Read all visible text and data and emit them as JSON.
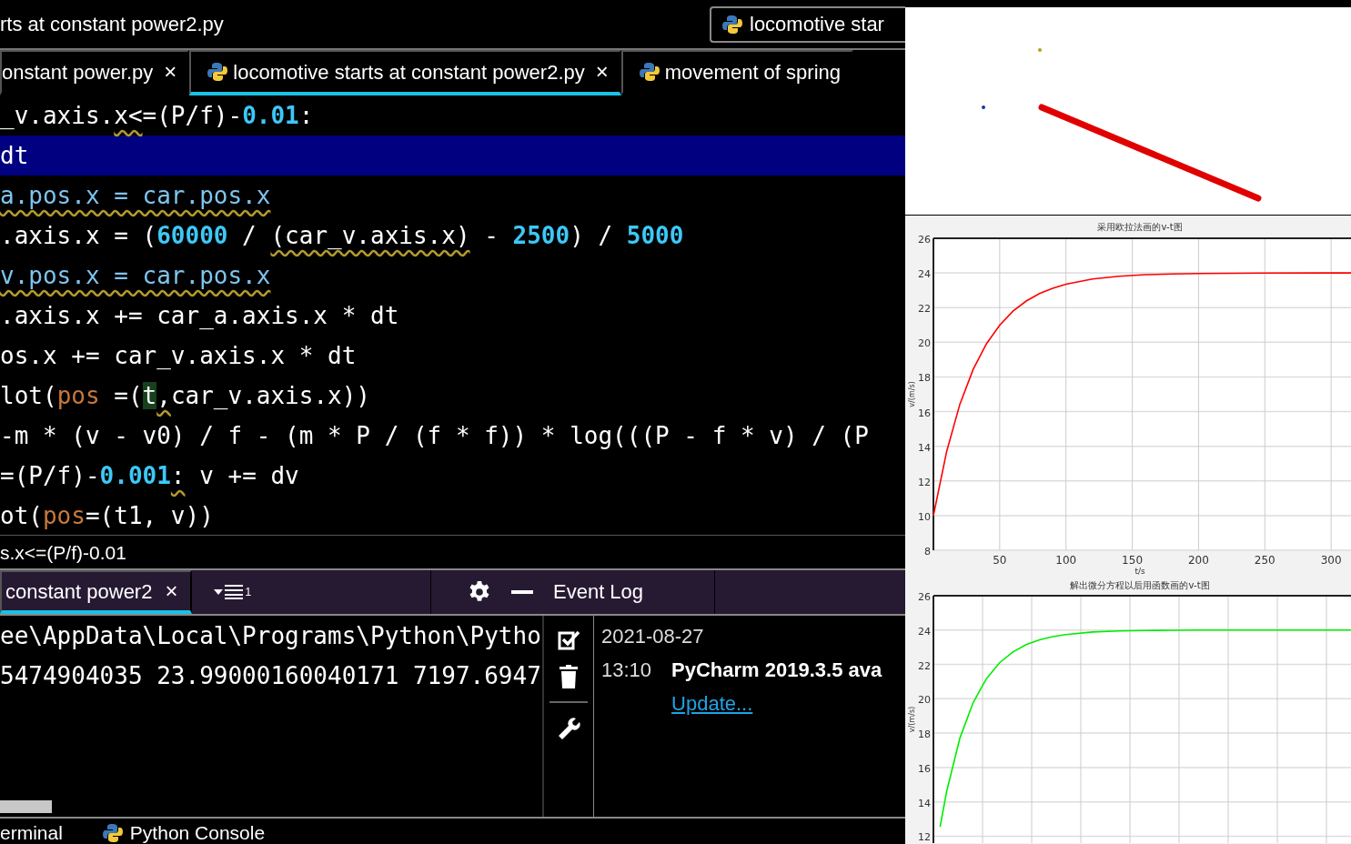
{
  "title_bar": {
    "title": "rts at constant power2.py",
    "run_config": "locomotive star"
  },
  "editor_tabs": [
    {
      "label": "onstant power.py",
      "close": "×",
      "selected": false
    },
    {
      "label": "locomotive starts at constant power2.py",
      "close": "×",
      "selected": true
    },
    {
      "label": "movement of spring",
      "selected": false
    }
  ],
  "code_lines": [
    {
      "selected": false,
      "tokens": [
        {
          "kind": "plain",
          "text": "_v.axis."
        },
        {
          "kind": "warn",
          "text": "x<"
        },
        {
          "kind": "plain",
          "text": "=(P/f)-"
        },
        {
          "kind": "number",
          "text": "0.01"
        },
        {
          "kind": "plain",
          "text": ":"
        }
      ]
    },
    {
      "selected": true,
      "tokens": [
        {
          "kind": "plain",
          "text": "dt"
        }
      ]
    },
    {
      "selected": false,
      "tokens": [
        {
          "kind": "ref",
          "text": "a.pos.x = car.pos.x"
        }
      ]
    },
    {
      "selected": false,
      "tokens": [
        {
          "kind": "plain",
          "text": ".axis.x = ("
        },
        {
          "kind": "number",
          "text": "60000"
        },
        {
          "kind": "plain",
          "text": " / "
        },
        {
          "kind": "warn",
          "text": "(car_v.axis.x)"
        },
        {
          "kind": "plain",
          "text": " - "
        },
        {
          "kind": "number",
          "text": "2500"
        },
        {
          "kind": "plain",
          "text": ") / "
        },
        {
          "kind": "number",
          "text": "5000"
        }
      ]
    },
    {
      "selected": false,
      "tokens": [
        {
          "kind": "ref",
          "text": "v.pos.x = car.pos.x"
        }
      ]
    },
    {
      "selected": false,
      "tokens": [
        {
          "kind": "plain",
          "text": ".axis.x += car_a.axis.x * dt"
        }
      ]
    },
    {
      "selected": false,
      "tokens": [
        {
          "kind": "plain",
          "text": "os.x += car_v.axis.x * dt"
        }
      ]
    },
    {
      "selected": false,
      "tokens": [
        {
          "kind": "plain",
          "text": "lot("
        },
        {
          "kind": "param",
          "text": "pos"
        },
        {
          "kind": "plain",
          "text": " =("
        },
        {
          "kind": "caret",
          "text": "t"
        },
        {
          "kind": "warn",
          "text": ","
        },
        {
          "kind": "plain",
          "text": "car_v.axis.x))"
        }
      ]
    },
    {
      "selected": false,
      "tokens": [
        {
          "kind": "plain",
          "text": "-m * (v - v0) / f - (m * P / (f * f)) * log(((P - f * v) / (P"
        }
      ]
    },
    {
      "selected": false,
      "tokens": [
        {
          "kind": "plain",
          "text": "=(P/f)-"
        },
        {
          "kind": "number",
          "text": "0.001"
        },
        {
          "kind": "warn",
          "text": ":"
        },
        {
          "kind": "plain",
          "text": " v += dv"
        }
      ]
    },
    {
      "selected": false,
      "tokens": [
        {
          "kind": "plain",
          "text": "ot("
        },
        {
          "kind": "param",
          "text": "pos"
        },
        {
          "kind": "plain",
          "text": "=(t1, v))"
        }
      ]
    }
  ],
  "status_line": "s.x<=(P/f)-0.01",
  "run_panel": {
    "tabs": [
      {
        "label": "constant power2",
        "close": "×",
        "selected": true
      }
    ],
    "layout_count": "1",
    "console_lines": [
      "ee\\AppData\\Local\\Programs\\Python\\Pytho",
      "5474904035 23.99000160040171 7197.6947"
    ]
  },
  "event_log": {
    "title": "Event Log",
    "date": "2021-08-27",
    "entries": [
      {
        "time": "13:10",
        "message": "PyCharm 2019.3.5 ava",
        "link": "Update..."
      }
    ]
  },
  "bottom_tabs": [
    {
      "label": "erminal",
      "kind": "plain"
    },
    {
      "label": "Python Console",
      "kind": "python"
    }
  ],
  "charts": [
    {
      "chart_data": {
        "type": "line",
        "title": "采用欧拉法画的v-t图",
        "xlabel": "t/s",
        "ylabel": "v/(m/s)",
        "x": [
          0,
          10,
          20,
          30,
          40,
          50,
          60,
          70,
          80,
          90,
          100,
          120,
          140,
          160,
          180,
          200,
          250,
          300,
          315
        ],
        "series": [
          {
            "color": "#ff0000",
            "values": [
              10,
              13.71,
              16.43,
              18.44,
              19.91,
              20.99,
              21.79,
              22.38,
              22.81,
              23.12,
              23.35,
              23.65,
              23.81,
              23.9,
              23.94,
              23.97,
              23.99,
              24,
              24
            ]
          }
        ],
        "xlim": [
          0,
          315
        ],
        "ylim": [
          8,
          26
        ],
        "xticks": [
          50,
          100,
          150,
          200,
          250,
          300
        ],
        "yticks": [
          8,
          10,
          12,
          14,
          16,
          18,
          20,
          22,
          24,
          26
        ],
        "grid": true
      }
    },
    {
      "chart_data": {
        "type": "line",
        "title": "解出微分方程以后用函数画的v-t图",
        "ylabel": "v/(m/s)",
        "x": [
          5,
          10,
          20,
          30,
          40,
          50,
          60,
          70,
          80,
          90,
          100,
          120,
          140,
          160,
          180,
          200,
          250,
          300,
          315
        ],
        "series": [
          {
            "color": "#00ee00",
            "values": [
              12.54,
              14.62,
              17.71,
              19.78,
              21.17,
              22.11,
              22.73,
              23.15,
              23.43,
              23.62,
              23.74,
              23.89,
              23.95,
              23.98,
              23.99,
              24,
              24,
              24,
              24
            ]
          }
        ],
        "xlim": [
          0,
          315
        ],
        "ylim": [
          11.6,
          26
        ],
        "yticks": [
          12,
          14,
          16,
          18,
          20,
          22,
          24,
          26
        ],
        "grid": true
      }
    }
  ]
}
